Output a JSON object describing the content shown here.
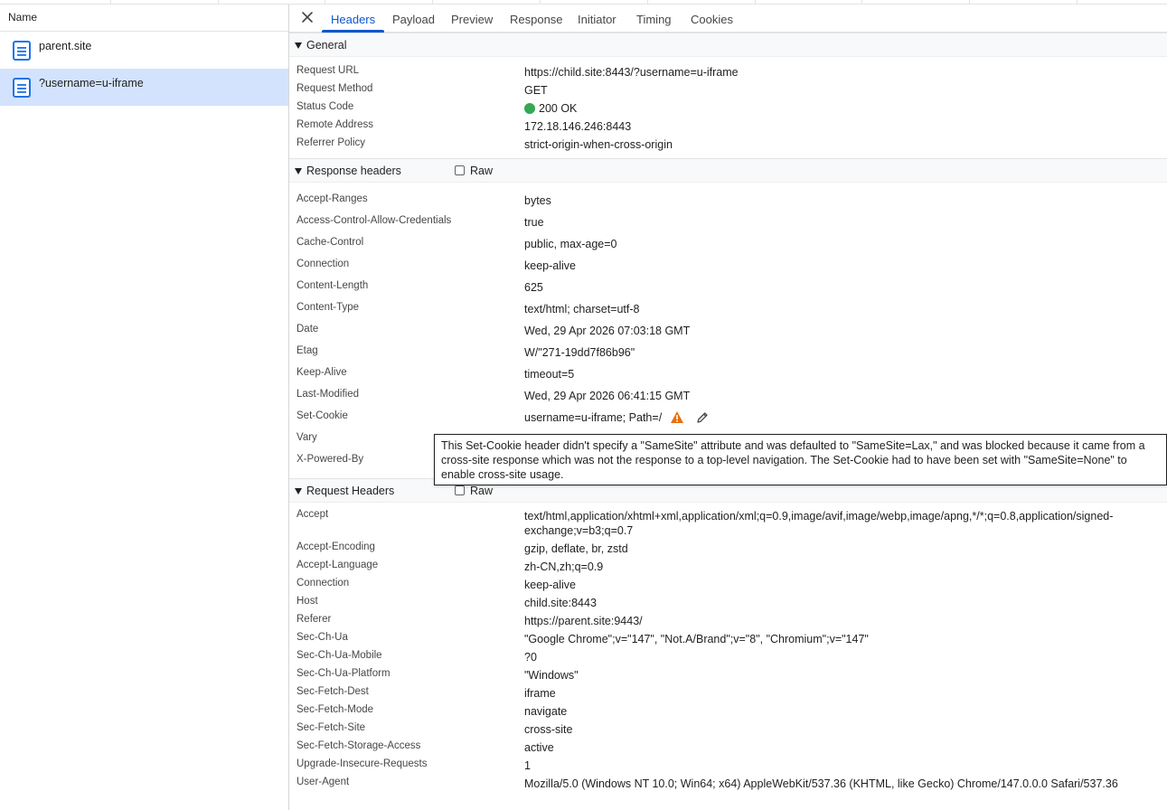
{
  "left_panel": {
    "column_header": "Name",
    "requests": [
      {
        "name": "parent.site",
        "selected": false
      },
      {
        "name": "?username=u-iframe",
        "selected": true
      }
    ]
  },
  "tabs": [
    "Headers",
    "Payload",
    "Preview",
    "Response",
    "Initiator",
    "Timing",
    "Cookies"
  ],
  "active_tab": "Headers",
  "general": {
    "title": "General",
    "rows": [
      {
        "name": "Request URL",
        "value": "https://child.site:8443/?username=u-iframe"
      },
      {
        "name": "Request Method",
        "value": "GET"
      },
      {
        "name": "Status Code",
        "value": "200 OK",
        "status_color": "#34a853"
      },
      {
        "name": "Remote Address",
        "value": "172.18.146.246:8443"
      },
      {
        "name": "Referrer Policy",
        "value": "strict-origin-when-cross-origin"
      }
    ]
  },
  "response_headers": {
    "title": "Response headers",
    "raw_label": "Raw",
    "rows": [
      {
        "name": "Accept-Ranges",
        "value": "bytes"
      },
      {
        "name": "Access-Control-Allow-Credentials",
        "value": "true"
      },
      {
        "name": "Cache-Control",
        "value": "public, max-age=0"
      },
      {
        "name": "Connection",
        "value": "keep-alive"
      },
      {
        "name": "Content-Length",
        "value": "625"
      },
      {
        "name": "Content-Type",
        "value": "text/html; charset=utf-8"
      },
      {
        "name": "Date",
        "value": "Wed, 29 Apr 2026 07:03:18 GMT"
      },
      {
        "name": "Etag",
        "value": "W/\"271-19dd7f86b96\""
      },
      {
        "name": "Keep-Alive",
        "value": "timeout=5"
      },
      {
        "name": "Last-Modified",
        "value": "Wed, 29 Apr 2026 06:41:15 GMT"
      },
      {
        "name": "Set-Cookie",
        "value": "username=u-iframe; Path=/"
      },
      {
        "name": "Vary",
        "value": ""
      },
      {
        "name": "X-Powered-By",
        "value": ""
      }
    ]
  },
  "tooltip": {
    "text": "This Set-Cookie header didn't specify a \"SameSite\" attribute and was defaulted to \"SameSite=Lax,\" and was blocked because it came from a cross-site response which was not the response to a top-level navigation. The Set-Cookie had to have been set with \"SameSite=None\" to enable cross-site usage."
  },
  "request_headers": {
    "title": "Request Headers",
    "raw_label": "Raw",
    "rows": [
      {
        "name": "Accept",
        "value": "text/html,application/xhtml+xml,application/xml;q=0.9,image/avif,image/webp,image/apng,*/*;q=0.8,application/signed-exchange;v=b3;q=0.7"
      },
      {
        "name": "Accept-Encoding",
        "value": "gzip, deflate, br, zstd"
      },
      {
        "name": "Accept-Language",
        "value": "zh-CN,zh;q=0.9"
      },
      {
        "name": "Connection",
        "value": "keep-alive"
      },
      {
        "name": "Host",
        "value": "child.site:8443"
      },
      {
        "name": "Referer",
        "value": "https://parent.site:9443/"
      },
      {
        "name": "Sec-Ch-Ua",
        "value": "\"Google Chrome\";v=\"147\", \"Not.A/Brand\";v=\"8\", \"Chromium\";v=\"147\""
      },
      {
        "name": "Sec-Ch-Ua-Mobile",
        "value": "?0"
      },
      {
        "name": "Sec-Ch-Ua-Platform",
        "value": "\"Windows\""
      },
      {
        "name": "Sec-Fetch-Dest",
        "value": "iframe"
      },
      {
        "name": "Sec-Fetch-Mode",
        "value": "navigate"
      },
      {
        "name": "Sec-Fetch-Site",
        "value": "cross-site"
      },
      {
        "name": "Sec-Fetch-Storage-Access",
        "value": "active"
      },
      {
        "name": "Upgrade-Insecure-Requests",
        "value": "1"
      },
      {
        "name": "User-Agent",
        "value": "Mozilla/5.0 (Windows NT 10.0; Win64; x64) AppleWebKit/537.36 (KHTML, like Gecko) Chrome/147.0.0.0 Safari/537.36"
      }
    ]
  },
  "colors": {
    "accent": "#0b57d0",
    "selected_row": "#d3e3fd",
    "warning": "#e8710a"
  }
}
